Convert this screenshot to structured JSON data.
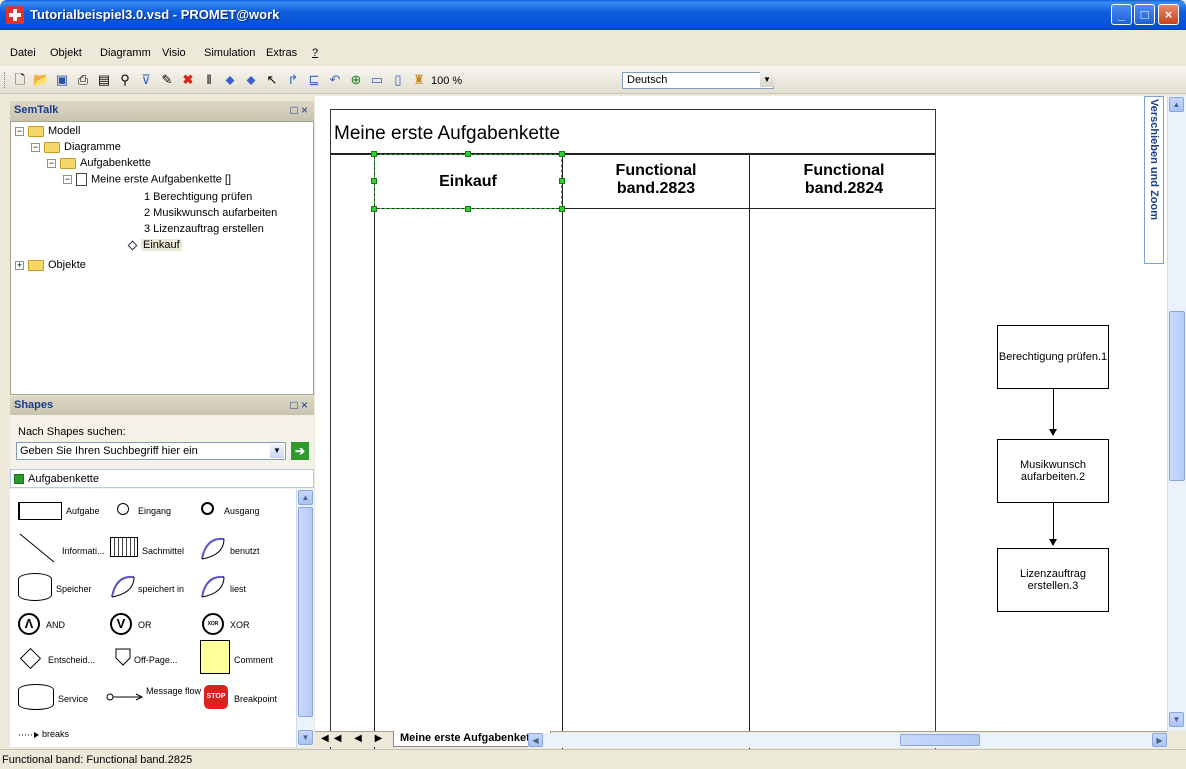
{
  "window": {
    "title": "Tutorialbeispiel3.0.vsd - PROMET@work"
  },
  "menu": [
    "Datei",
    "Objekt",
    "Diagramm",
    "Visio",
    "Simulation",
    "Extras",
    "?"
  ],
  "toolbar": {
    "zoom": "100 %",
    "language": "Deutsch",
    "icons": [
      "new-icon",
      "open-icon",
      "save-icon",
      "print-icon",
      "properties-icon",
      "find-icon",
      "filter-icon",
      "edit-icon",
      "delete-icon",
      "attach-icon",
      "move-down-icon",
      "move-up-icon",
      "pointer-icon",
      "connector-icon",
      "layout-icon",
      "undo-icon",
      "zoom-icon",
      "band-h-icon",
      "band-v-icon",
      "user-icon"
    ]
  },
  "semtalk": {
    "title": "SemTalk",
    "tree": {
      "model": "Modell",
      "diagrams": "Diagramme",
      "chain": "Aufgabenkette",
      "diagram": "Meine erste Aufgabenkette []",
      "tasks": [
        "1 Berechtigung prüfen",
        "2 Musikwunsch aufarbeiten",
        "3 Lizenzauftrag erstellen"
      ],
      "selected": "Einkauf",
      "objects": "Objekte"
    }
  },
  "shapes": {
    "title": "Shapes",
    "search_label": "Nach Shapes suchen:",
    "search_placeholder": "Geben Sie Ihren Suchbegriff hier ein",
    "stencil": "Aufgabenkette",
    "items": {
      "aufgabe": "Aufgabe",
      "eingang": "Eingang",
      "ausgang": "Ausgang",
      "information": "Informati...",
      "sachmittel": "Sachmittel",
      "benutzt": "benutzt",
      "speicher": "Speicher",
      "speichert_in": "speichert in",
      "liest": "liest",
      "and": "AND",
      "or": "OR",
      "xor": "XOR",
      "entscheid": "Entscheid...",
      "offpage": "Off-Page...",
      "comment": "Comment",
      "service": "Service",
      "message_flow": "Message flow",
      "breakpoint": "Breakpoint",
      "breaks": "breaks",
      "and_glyph": "Λ",
      "or_glyph": "V",
      "xor_glyph": "XOR",
      "stop_glyph": "STOP"
    }
  },
  "diagram": {
    "title": "Meine erste Aufgabenkette",
    "lanes": [
      "Einkauf",
      "Functional band.2823",
      "Functional band.2824"
    ],
    "processes": [
      "Berechtigung prüfen.1",
      "Musikwunsch aufarbeiten.2",
      "Lizenzauftrag erstellen.3"
    ]
  },
  "side_panel": "Verschieben und Zoom",
  "page_tab": "Meine erste Aufgabenkette",
  "status": "Functional band: Functional band.2825"
}
